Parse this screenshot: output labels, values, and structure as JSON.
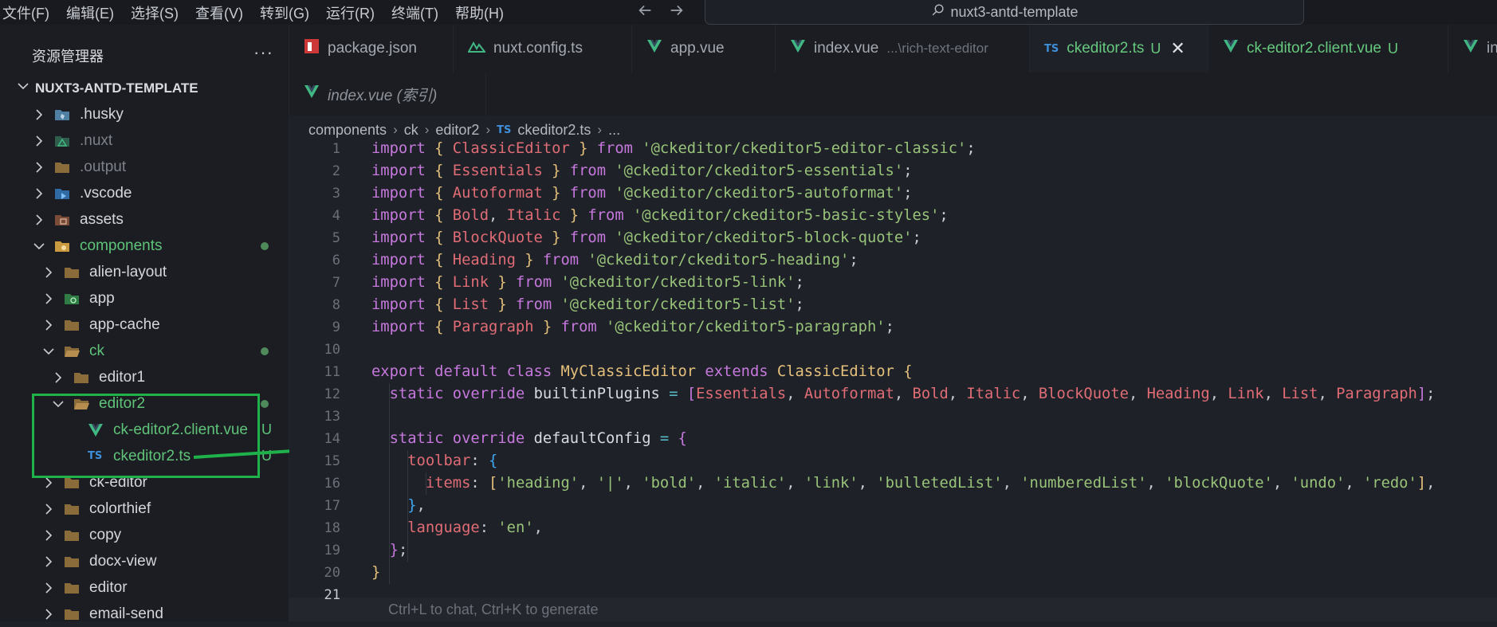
{
  "menu": [
    "文件(F)",
    "编辑(E)",
    "选择(S)",
    "查看(V)",
    "转到(G)",
    "运行(R)",
    "终端(T)",
    "帮助(H)"
  ],
  "command_center": {
    "text": "nuxt3-antd-template"
  },
  "sidebar": {
    "title": "资源管理器",
    "more": "···",
    "project": "NUXT3-ANTD-TEMPLATE",
    "items": [
      {
        "label": ".husky",
        "icon": "husky-folder-icon"
      },
      {
        "label": ".nuxt",
        "icon": "nuxt-folder-icon"
      },
      {
        "label": ".output",
        "icon": "folder-icon"
      },
      {
        "label": ".vscode",
        "icon": "vscode-folder-icon"
      },
      {
        "label": "assets",
        "icon": "assets-folder-icon"
      },
      {
        "label": "components",
        "icon": "components-folder-icon"
      },
      {
        "label": "alien-layout",
        "icon": "folder-icon"
      },
      {
        "label": "app",
        "icon": "app-folder-icon"
      },
      {
        "label": "app-cache",
        "icon": "folder-icon"
      },
      {
        "label": "ck",
        "icon": "folder-open-icon"
      },
      {
        "label": "editor1",
        "icon": "folder-icon"
      },
      {
        "label": "editor2",
        "icon": "folder-open-icon"
      },
      {
        "label": "ck-editor2.client.vue",
        "icon": "vue-file-icon",
        "status": "U"
      },
      {
        "label": "ckeditor2.ts",
        "icon": "ts-file-icon",
        "status": "U"
      },
      {
        "label": "ck-editor",
        "icon": "folder-icon"
      },
      {
        "label": "colorthief",
        "icon": "folder-icon"
      },
      {
        "label": "copy",
        "icon": "folder-icon"
      },
      {
        "label": "docx-view",
        "icon": "folder-icon"
      },
      {
        "label": "editor",
        "icon": "folder-icon"
      },
      {
        "label": "email-send",
        "icon": "folder-icon"
      }
    ]
  },
  "tabs": [
    {
      "label": "package.json",
      "icon": "npm-icon"
    },
    {
      "label": "nuxt.config.ts",
      "icon": "nuxt-icon"
    },
    {
      "label": "app.vue",
      "icon": "vue-icon"
    },
    {
      "label": "index.vue",
      "desc": "...\\rich-text-editor",
      "icon": "vue-icon"
    },
    {
      "label": "ckeditor2.ts",
      "status": "U",
      "close": "✕",
      "icon": "ts-icon"
    },
    {
      "label": "ck-editor2.client.vue",
      "status": "U",
      "icon": "vue-icon"
    },
    {
      "label": "index.vu",
      "icon": "vue-icon"
    }
  ],
  "pinned_tab": {
    "label": "index.vue (索引)"
  },
  "breadcrumb": {
    "parts": [
      "components",
      "ck",
      "editor2"
    ],
    "file": "ckeditor2.ts",
    "tail": "...",
    "file_badge": "TS"
  },
  "editor": {
    "line_numbers": [
      "1",
      "2",
      "3",
      "4",
      "5",
      "6",
      "7",
      "8",
      "9",
      "10",
      "11",
      "12",
      "13",
      "14",
      "15",
      "16",
      "17",
      "18",
      "19",
      "20",
      "21"
    ],
    "lines": [
      "import { ClassicEditor } from '@ckeditor/ckeditor5-editor-classic';",
      "import { Essentials } from '@ckeditor/ckeditor5-essentials';",
      "import { Autoformat } from '@ckeditor/ckeditor5-autoformat';",
      "import { Bold, Italic } from '@ckeditor/ckeditor5-basic-styles';",
      "import { BlockQuote } from '@ckeditor/ckeditor5-block-quote';",
      "import { Heading } from '@ckeditor/ckeditor5-heading';",
      "import { Link } from '@ckeditor/ckeditor5-link';",
      "import { List } from '@ckeditor/ckeditor5-list';",
      "import { Paragraph } from '@ckeditor/ckeditor5-paragraph';",
      "",
      "export default class MyClassicEditor extends ClassicEditor {",
      "  static override builtinPlugins = [Essentials, Autoformat, Bold, Italic, BlockQuote, Heading, Link, List, Paragraph];",
      "",
      "  static override defaultConfig = {",
      "    toolbar: {",
      "      items: ['heading', '|', 'bold', 'italic', 'link', 'bulletedList', 'numberedList', 'blockQuote', 'undo', 'redo'],",
      "    },",
      "    language: 'en',",
      "  };",
      "}",
      ""
    ],
    "hint": "Ctrl+L to chat, Ctrl+K to generate"
  },
  "colors": {
    "accent_green": "#5fc479",
    "annotation_green": "#1fb24a",
    "ts_blue": "#3e8fd9",
    "vue_green": "#41b883"
  }
}
